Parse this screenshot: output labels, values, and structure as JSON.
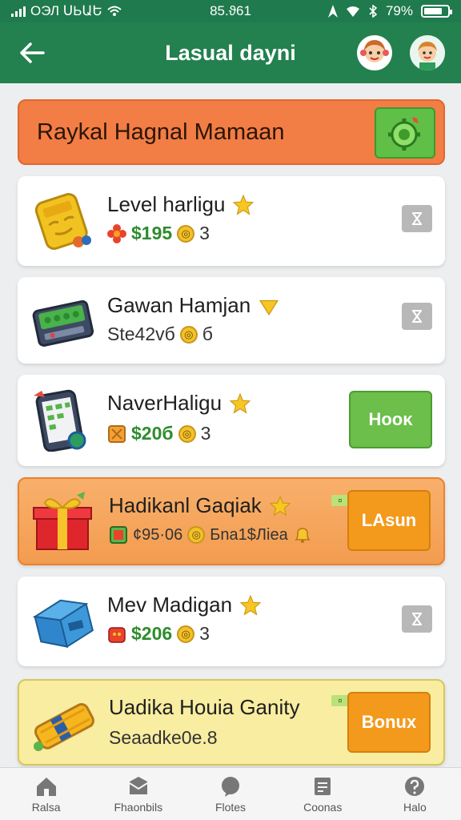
{
  "status_bar": {
    "carrier": "ОЭЛ ՍЬԱԵ",
    "time": "85.ϑ61",
    "battery_percent": "79%",
    "battery_level": 0.79
  },
  "header": {
    "title": "Lasual dayni"
  },
  "banner": {
    "title": "Raykal Hagnal Mamaan"
  },
  "items": [
    {
      "title": "Level harligu",
      "price": "$195",
      "coin": "3",
      "action": ""
    },
    {
      "title": "Gawan Hamjan",
      "sub": "Ste42vб",
      "coin": "б",
      "action": ""
    },
    {
      "title": "NaverHaligu",
      "price": "$20б",
      "coin": "3",
      "action": "Hooκ"
    },
    {
      "title": "Hadikanl Gaqiak",
      "sub": "¢95·06",
      "coin_text": "Бna1$Лiea",
      "tag": "¤",
      "action": "LAsun"
    },
    {
      "title": "Mev Madigan",
      "price": "$206",
      "coin": "3",
      "action": ""
    },
    {
      "title": "Uadika Houia Ganity",
      "sub": "Seaadke0e.8",
      "tag": "¤",
      "action": "Bonux"
    }
  ],
  "nav": [
    {
      "label": "Ralsa",
      "icon": "home-icon"
    },
    {
      "label": "Fhaonbils",
      "icon": "mail-icon"
    },
    {
      "label": "Flotes",
      "icon": "chat-icon"
    },
    {
      "label": "Coonas",
      "icon": "note-icon"
    },
    {
      "label": "Halo",
      "icon": "help-icon"
    }
  ]
}
